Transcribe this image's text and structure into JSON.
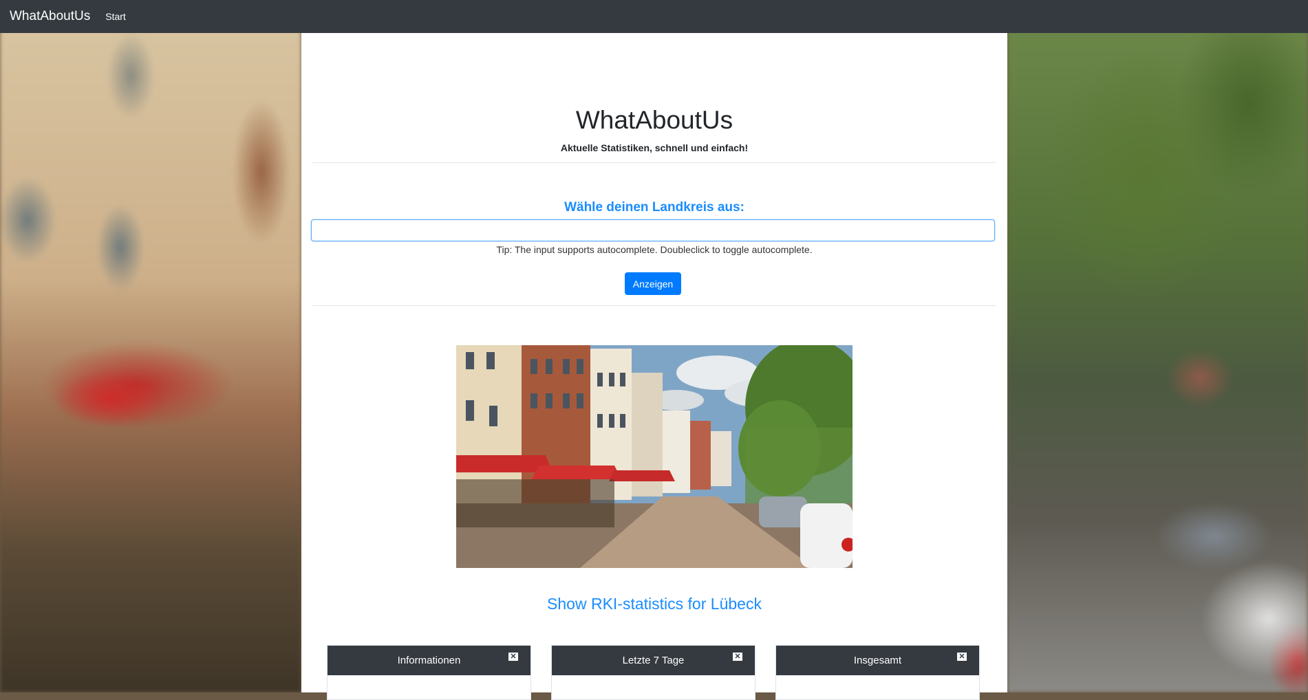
{
  "navbar": {
    "brand": "WhatAboutUs",
    "links": [
      "Start"
    ]
  },
  "header": {
    "title": "WhatAboutUs",
    "subtitle": "Aktuelle Statistiken, schnell und einfach!"
  },
  "district_form": {
    "label": "Wähle deinen Landkreis aus:",
    "input_value": "",
    "tip": "Tip: The input supports autocomplete. Doubleclick to toggle autocomplete.",
    "button_label": "Anzeigen"
  },
  "stats_link": "Show RKI-statistics for Lübeck",
  "cards": [
    {
      "title": "Informationen",
      "close": "✕"
    },
    {
      "title": "Letzte 7 Tage",
      "close": "✕"
    },
    {
      "title": "Insgesamt",
      "close": "✕"
    }
  ],
  "colors": {
    "navbar": "#343a40",
    "accent": "#007bff",
    "link": "#1a8cff"
  }
}
